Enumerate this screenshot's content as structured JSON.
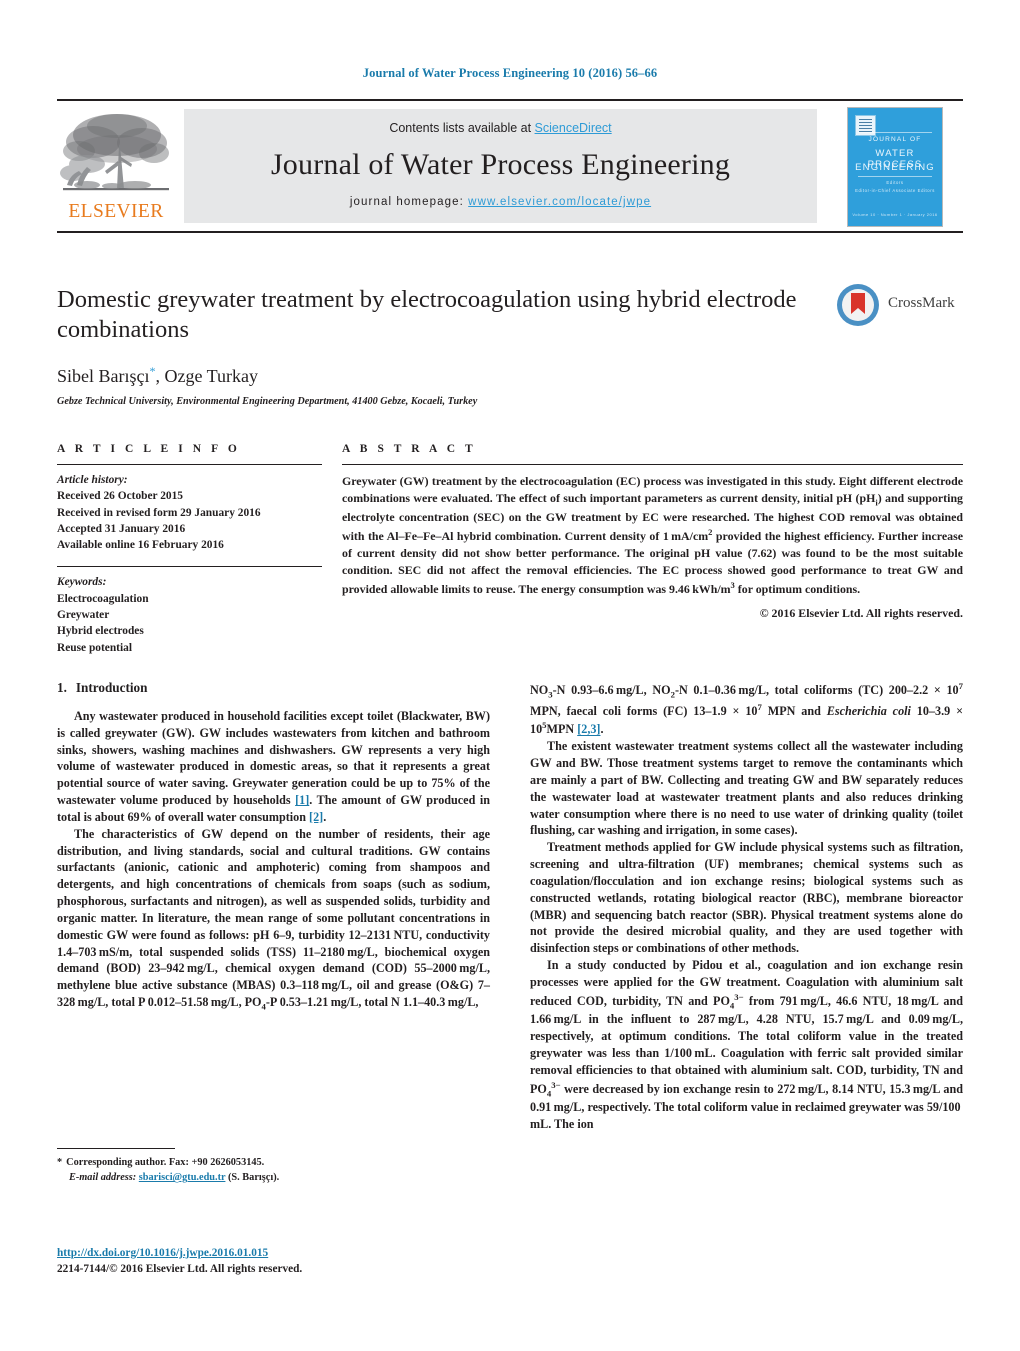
{
  "running_head": "Journal of Water Process Engineering 10 (2016) 56–66",
  "masthead": {
    "contents_prefix": "Contents lists available at ",
    "sciencedirect": "ScienceDirect",
    "journal_title": "Journal of Water Process Engineering",
    "homepage_prefix": "journal homepage: ",
    "homepage_url": "www.elsevier.com/locate/jwpe",
    "publisher_wordmark": "ELSEVIER",
    "publisher_logo_icon": "elsevier-tree-icon",
    "cover": {
      "line1": "JOURNAL OF",
      "line2": "WATER PROCESS",
      "line3": "ENGINEERING",
      "editor_label": "Editors",
      "editor_names": "Editor-in-Chief    Associate Editors",
      "footer": "Volume 10 · Number 1 · January 2016"
    }
  },
  "crossmark": {
    "label": "CrossMark",
    "icon": "crossmark-badge-icon"
  },
  "article": {
    "title": "Domestic greywater treatment by electrocoagulation using hybrid electrode combinations",
    "authors_part1": "Sibel Barışçı",
    "authors_star": "*",
    "authors_part2": ", Ozge Turkay",
    "affiliation": "Gebze Technical University, Environmental Engineering Department, 41400 Gebze, Kocaeli, Turkey"
  },
  "article_info": {
    "heading": "A R T I C L E   I N F O",
    "history_label": "Article history:",
    "history": [
      "Received 26 October 2015",
      "Received in revised form 29 January 2016",
      "Accepted 31 January 2016",
      "Available online 16 February 2016"
    ],
    "keywords_label": "Keywords:",
    "keywords": [
      "Electrocoagulation",
      "Greywater",
      "Hybrid electrodes",
      "Reuse potential"
    ]
  },
  "abstract": {
    "heading": "A B S T R A C T",
    "text": "Greywater (GW) treatment by the electrocoagulation (EC) process was investigated in this study. Eight different electrode combinations were evaluated. The effect of such important parameters as current density, initial pH (pHi) and supporting electrolyte concentration (SEC) on the GW treatment by EC were researched. The highest COD removal was obtained with the Al–Fe–Fe–Al hybrid combination. Current density of 1 mA/cm2 provided the highest efficiency. Further increase of current density did not show better performance. The original pH value (7.62) was found to be the most suitable condition. SEC did not affect the removal efficiencies. The EC process showed good performance to treat GW and provided allowable limits to reuse. The energy consumption was 9.46 kWh/m3 for optimum conditions.",
    "copyright": "© 2016 Elsevier Ltd. All rights reserved."
  },
  "body": {
    "section1_number": "1.",
    "section1_title": "Introduction",
    "left_paragraphs": [
      "Any wastewater produced in household facilities except toilet (Blackwater, BW) is called greywater (GW). GW includes wastewaters from kitchen and bathroom sinks, showers, washing machines and dishwashers. GW represents a very high volume of wastewater produced in domestic areas, so that it represents a great potential source of water saving. Greywater generation could be up to 75% of the wastewater volume produced by households [1]. The amount of GW produced in total is about 69% of overall water consumption [2].",
      "The characteristics of GW depend on the number of residents, their age distribution, and living standards, social and cultural traditions. GW contains surfactants (anionic, cationic and amphoteric) coming from shampoos and detergents, and high concentrations of chemicals from soaps (such as sodium, phosphorous, surfactants and nitrogen), as well as suspended solids, turbidity and organic matter. In literature, the mean range of some pollutant concentrations in domestic GW were found as follows: pH 6–9, turbidity 12–2131 NTU, conductivity 1.4–703 mS/m, total suspended solids (TSS) 11–2180 mg/L, biochemical oxygen demand (BOD) 23–942 mg/L, chemical oxygen demand (COD) 55–2000 mg/L, methylene blue active substance (MBAS) 0.3–118 mg/L, oil and grease (O&G) 7–328 mg/L, total P 0.012–51.58 mg/L, PO4-P 0.53–1.21 mg/L, total N 1.1–40.3 mg/L,"
    ],
    "right_paragraphs": [
      "NO3-N 0.93–6.6 mg/L, NO2-N 0.1–0.36 mg/L, total coliforms (TC) 200–2.2 × 107 MPN, faecal coli forms (FC) 13–1.9 × 107 MPN and Escherichia coli 10–3.9 × 105MPN [2,3].",
      "The existent wastewater treatment systems collect all the wastewater including GW and BW. Those treatment systems target to remove the contaminants which are mainly a part of BW. Collecting and treating GW and BW separately reduces the wastewater load at wastewater treatment plants and also reduces drinking water consumption where there is no need to use water of drinking quality (toilet flushing, car washing and irrigation, in some cases).",
      "Treatment methods applied for GW include physical systems such as filtration, screening and ultra-filtration (UF) membranes; chemical systems such as coagulation/flocculation and ion exchange resins; biological systems such as constructed wetlands, rotating biological reactor (RBC), membrane bioreactor (MBR) and sequencing batch reactor (SBR). Physical treatment systems alone do not provide the desired microbial quality, and they are used together with disinfection steps or combinations of other methods.",
      "In a study conducted by Pidou et al., coagulation and ion exchange resin processes were applied for the GW treatment. Coagulation with aluminium salt reduced COD, turbidity, TN and PO43− from 791 mg/L, 46.6 NTU, 18 mg/L and 1.66 mg/L in the influent to 287 mg/L, 4.28 NTU, 15.7 mg/L and 0.09 mg/L, respectively, at optimum conditions. The total coliform value in the treated greywater was less than 1/100 mL. Coagulation with ferric salt provided similar removal efficiencies to that obtained with aluminium salt. COD, turbidity, TN and PO43− were decreased by ion exchange resin to 272 mg/L, 8.14 NTU, 15.3 mg/L and 0.91 mg/L, respectively. The total coliform value in reclaimed greywater was 59/100 mL. The ion"
    ]
  },
  "footnote": {
    "star": "*",
    "corresponding": "Corresponding author. Fax: +90 2626053145.",
    "email_label": "E-mail address:",
    "email": "sbarisci@gtu.edu.tr",
    "email_suffix": "(S. Barışçı)."
  },
  "footer": {
    "doi": "http://dx.doi.org/10.1016/j.jwpe.2016.01.015",
    "issn_line": "2214-7144/© 2016 Elsevier Ltd. All rights reserved."
  },
  "colors": {
    "link_blue": "#1a7bab",
    "sciencedirect_blue": "#2e9bd6",
    "elsevier_orange": "#e87b1e",
    "cover_blue": "#2f9fdb",
    "text_black": "#231f20"
  }
}
